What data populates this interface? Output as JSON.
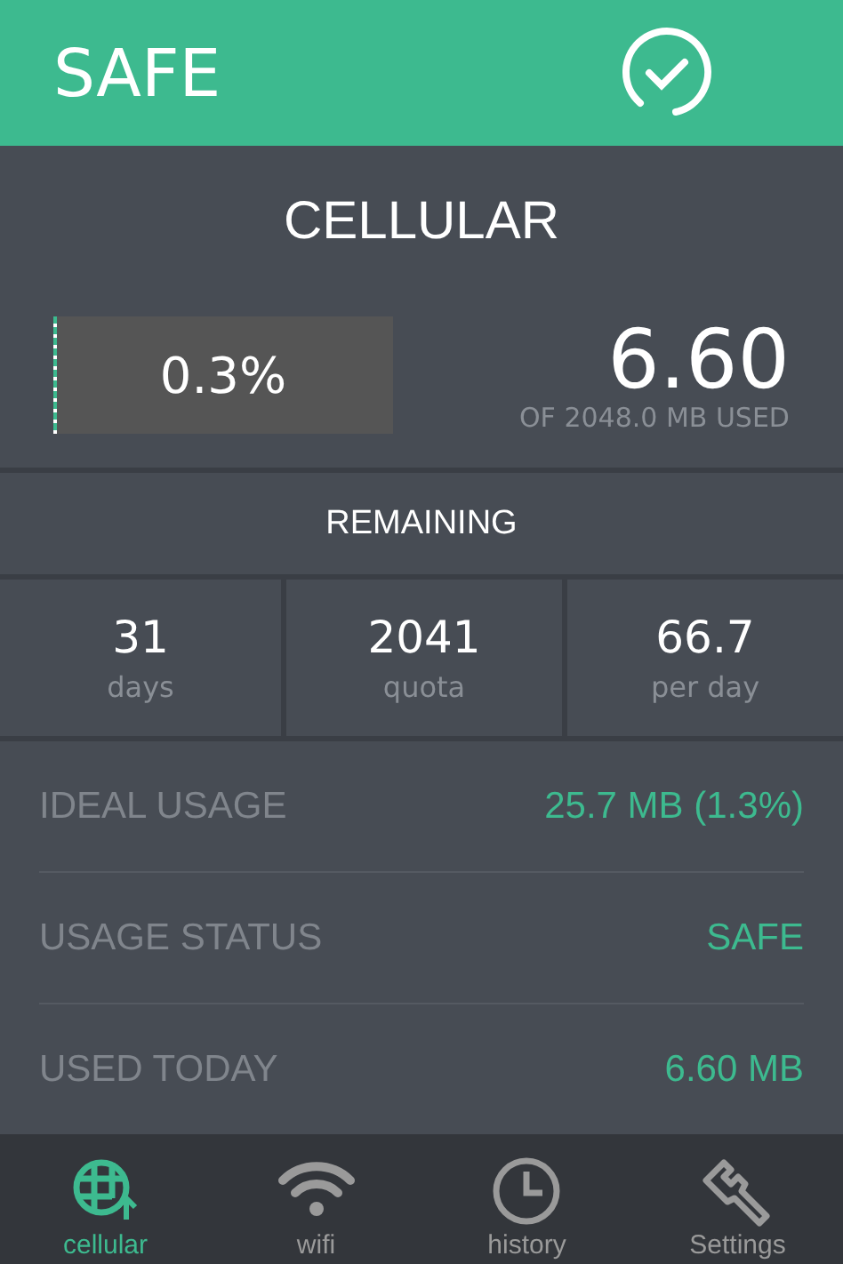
{
  "header": {
    "status": "SAFE"
  },
  "title": "CELLULAR",
  "usage": {
    "percent": "0.3%",
    "level": 0.003,
    "amount": "6.60",
    "caption": "OF 2048.0 MB USED"
  },
  "remaining": {
    "heading": "REMAINING",
    "stats": [
      {
        "value": "31",
        "label": "days"
      },
      {
        "value": "2041",
        "label": "quota"
      },
      {
        "value": "66.7",
        "label": "per day"
      }
    ]
  },
  "rows": [
    {
      "label": "IDEAL USAGE",
      "value": "25.7 MB (1.3%)"
    },
    {
      "label": "USAGE STATUS",
      "value": "SAFE"
    },
    {
      "label": "USED TODAY",
      "value": "6.60 MB"
    }
  ],
  "tabs": [
    {
      "kind": "cellular",
      "label": "cellular",
      "selected": true
    },
    {
      "kind": "wifi",
      "label": "wifi",
      "selected": false
    },
    {
      "kind": "history",
      "label": "history",
      "selected": false
    },
    {
      "kind": "settings",
      "label": "Settings",
      "selected": false
    }
  ]
}
